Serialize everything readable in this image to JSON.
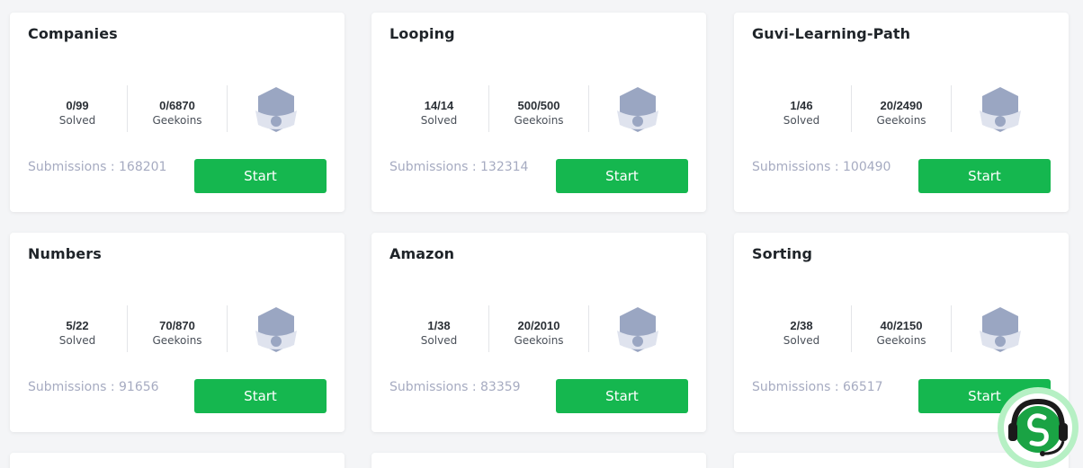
{
  "courses": [
    {
      "title": "Companies",
      "solved": "0/99",
      "solved_label": "Solved",
      "geekoins": "0/6870",
      "geekoins_label": "Geekoins",
      "submissions": "Submissions : 168201",
      "button": "Start"
    },
    {
      "title": "Looping",
      "solved": "14/14",
      "solved_label": "Solved",
      "geekoins": "500/500",
      "geekoins_label": "Geekoins",
      "submissions": "Submissions : 132314",
      "button": "Start"
    },
    {
      "title": "Guvi-Learning-Path",
      "solved": "1/46",
      "solved_label": "Solved",
      "geekoins": "20/2490",
      "geekoins_label": "Geekoins",
      "submissions": "Submissions : 100490",
      "button": "Start"
    },
    {
      "title": "Numbers",
      "solved": "5/22",
      "solved_label": "Solved",
      "geekoins": "70/870",
      "geekoins_label": "Geekoins",
      "submissions": "Submissions : 91656",
      "button": "Start"
    },
    {
      "title": "Amazon",
      "solved": "1/38",
      "solved_label": "Solved",
      "geekoins": "20/2010",
      "geekoins_label": "Geekoins",
      "submissions": "Submissions : 83359",
      "button": "Start"
    },
    {
      "title": "Sorting",
      "solved": "2/38",
      "solved_label": "Solved",
      "geekoins": "40/2150",
      "geekoins_label": "Geekoins",
      "submissions": "Submissions : 66517",
      "button": "Start"
    }
  ],
  "badge_icon": "locked-badge-icon",
  "chat_icon": "support-headset-icon",
  "colors": {
    "page_bg": "#f4f5f7",
    "card_bg": "#ffffff",
    "accent_green": "#15b74f",
    "submissions_text": "#a6abc1",
    "badge_gray": "#9aa6c2",
    "chat_bg": "#b6f0c4"
  }
}
